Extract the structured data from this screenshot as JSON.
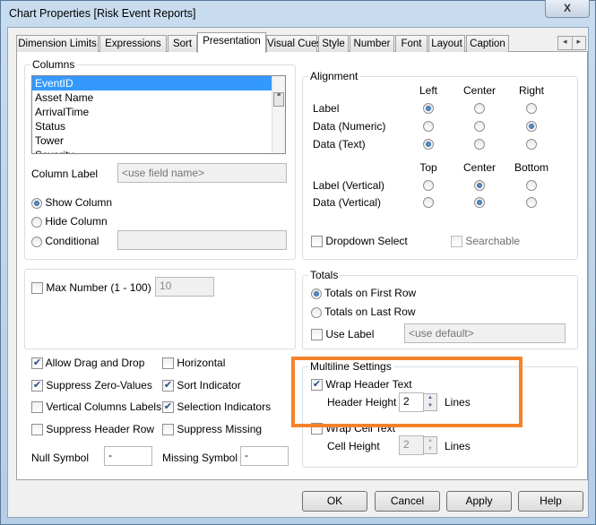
{
  "window": {
    "title": "Chart Properties [Risk Event Reports]",
    "close": "X"
  },
  "tabs": [
    "Dimension Limits",
    "Expressions",
    "Sort",
    "Presentation",
    "Visual Cues",
    "Style",
    "Number",
    "Font",
    "Layout",
    "Caption"
  ],
  "active_tab": "Presentation",
  "tab_scroll": {
    "left": "◂",
    "right": "▸"
  },
  "columns": {
    "legend": "Columns",
    "items": [
      "EventID",
      "Asset Name",
      "ArrivalTime",
      "Status",
      "Tower",
      "Severity"
    ],
    "selected": "EventID",
    "column_label": "Column Label",
    "column_label_placeholder": "<use field name>",
    "show": "Show Column",
    "hide": "Hide Column",
    "conditional": "Conditional",
    "visibility": "show"
  },
  "alignment": {
    "legend": "Alignment",
    "h_headers": [
      "Left",
      "Center",
      "Right"
    ],
    "v_headers": [
      "Top",
      "Center",
      "Bottom"
    ],
    "rows": [
      {
        "label": "Label",
        "value": 0
      },
      {
        "label": "Data (Numeric)",
        "value": 2
      },
      {
        "label": "Data (Text)",
        "value": 0
      }
    ],
    "vrows": [
      {
        "label": "Label (Vertical)",
        "value": 1
      },
      {
        "label": "Data (Vertical)",
        "value": 1
      }
    ],
    "dropdown_select": "Dropdown Select",
    "dropdown_checked": false,
    "searchable": "Searchable",
    "searchable_checked": false
  },
  "max_number": {
    "label": "Max Number (1 - 100)",
    "checked": false,
    "value": "10"
  },
  "totals": {
    "legend": "Totals",
    "first": "Totals on First Row",
    "last": "Totals on Last Row",
    "selected": "first",
    "use_label": "Use Label",
    "use_label_checked": false,
    "placeholder": "<use default>"
  },
  "options": [
    {
      "label": "Allow Drag and Drop",
      "checked": true
    },
    {
      "label": "Horizontal",
      "checked": false
    },
    {
      "label": "Suppress Zero-Values",
      "checked": true
    },
    {
      "label": "Sort Indicator",
      "checked": true
    },
    {
      "label": "Vertical Columns Labels",
      "checked": false
    },
    {
      "label": "Selection Indicators",
      "checked": true
    },
    {
      "label": "Suppress Header Row",
      "checked": false
    },
    {
      "label": "Suppress Missing",
      "checked": false
    }
  ],
  "null_symbol": {
    "label": "Null Symbol",
    "value": "-"
  },
  "missing_symbol": {
    "label": "Missing Symbol",
    "value": "-"
  },
  "multiline": {
    "legend": "Multiline Settings",
    "wrap_header": "Wrap Header Text",
    "wrap_header_checked": true,
    "header_height": "Header Height",
    "header_value": "2",
    "wrap_cell": "Wrap Cell Text",
    "wrap_cell_checked": false,
    "cell_height": "Cell Height",
    "cell_value": "2",
    "lines": "Lines"
  },
  "highlight_color": "#f5822a",
  "buttons": {
    "ok": "OK",
    "cancel": "Cancel",
    "apply": "Apply",
    "help": "Help"
  }
}
